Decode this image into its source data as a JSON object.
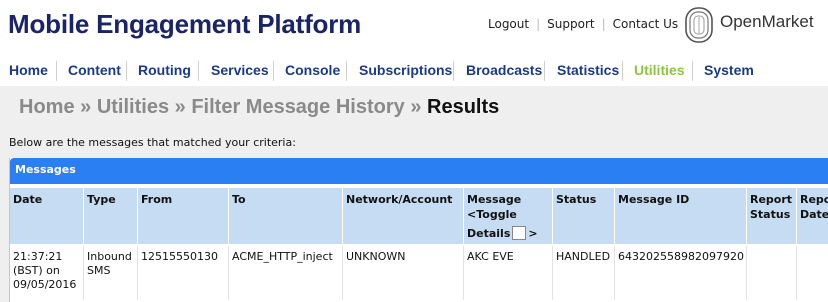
{
  "app": {
    "title": "Mobile Engagement Platform"
  },
  "top_links": [
    "Logout",
    "Support",
    "Contact Us"
  ],
  "logo": {
    "text": "OpenMarket"
  },
  "nav": [
    "Home",
    "Content",
    "Routing",
    "Services",
    "Console",
    "Subscriptions",
    "Broadcasts",
    "Statistics",
    "Utilities",
    "System"
  ],
  "nav_active": "Utilities",
  "colors": {
    "title": "#1a2466",
    "nav": "#1a3a8a",
    "nav_active": "#8cc63f",
    "panel_header": "#2a7ff2",
    "table_header": "#c6dcf3",
    "content_bg": "#efefef"
  },
  "breadcrumb": {
    "items": [
      "Home",
      "Utilities",
      "Filter Message History"
    ],
    "current": "Results",
    "separator": "»"
  },
  "intro_text": "Below are the messages that matched your criteria:",
  "panel": {
    "title": "Messages"
  },
  "table": {
    "headers": {
      "date": "Date",
      "type": "Type",
      "from": "From",
      "to": "To",
      "network": "Network/Account",
      "message_line1": "Message",
      "message_line2": "<Toggle",
      "message_line3": "Details",
      "message_line3_after": ">",
      "status": "Status",
      "message_id": "Message ID",
      "report_status_line1": "Report",
      "report_status_line2": "Status",
      "report_date_line1": "Repo",
      "report_date_line2": "Date"
    },
    "rows": [
      {
        "date_line1": "21:37:21",
        "date_line2": "(BST) on",
        "date_line3": "09/05/2016",
        "type_line1": "Inbound",
        "type_line2": "SMS",
        "from": "12515550130",
        "to": "ACME_HTTP_inject",
        "network": "UNKNOWN",
        "message": "AKC EVE",
        "status": "HANDLED",
        "message_id": "643202558982097920"
      }
    ]
  }
}
